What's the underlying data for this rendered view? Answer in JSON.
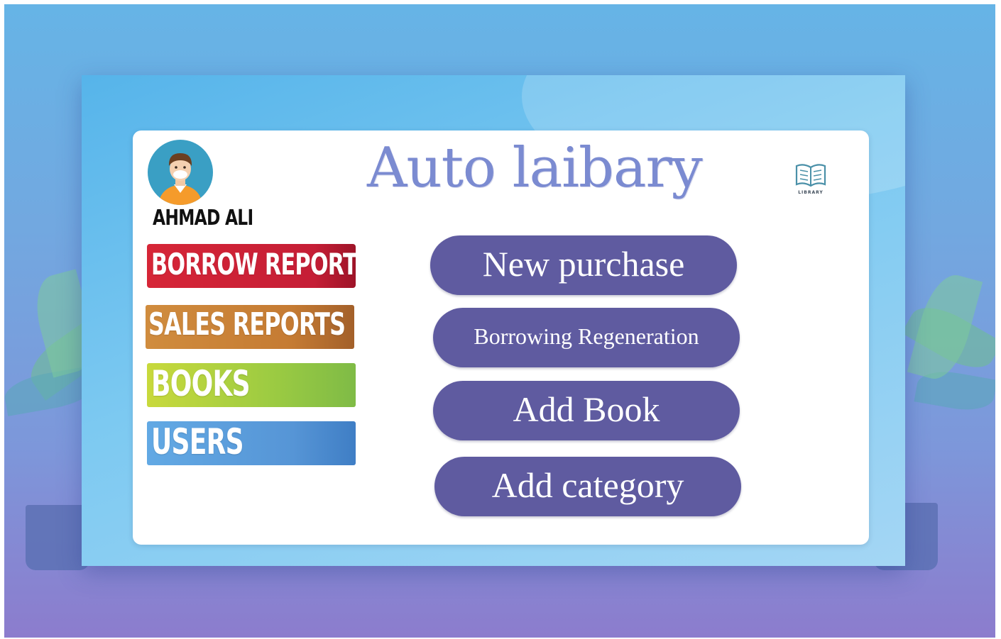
{
  "app": {
    "title": "Auto laibary",
    "logo_caption": "LIBRARY"
  },
  "user": {
    "name": "AHMAD ALI"
  },
  "sidebar": {
    "items": [
      {
        "label": "BORROW REPORTS",
        "color": "#d12a3a"
      },
      {
        "label": "SALES REPORTS",
        "color": "#c8823a"
      },
      {
        "label": "BOOKS",
        "color": "#a6cf3e"
      },
      {
        "label": "USERS",
        "color": "#5b9ad8"
      }
    ]
  },
  "actions": {
    "items": [
      {
        "label": "New purchase"
      },
      {
        "label": "Borrowing Regeneration"
      },
      {
        "label": "Add Book"
      },
      {
        "label": "Add category"
      }
    ],
    "color": "#5f5ba0"
  }
}
